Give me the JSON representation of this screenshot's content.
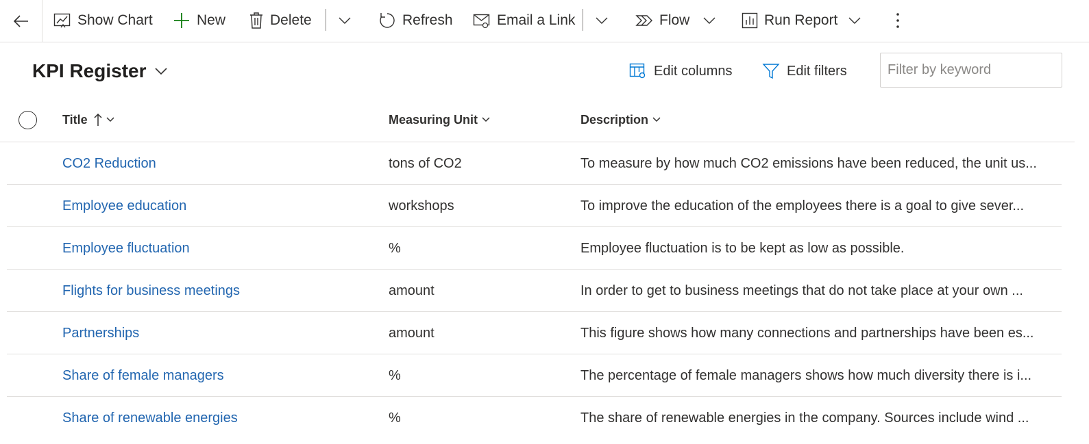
{
  "commandbar": {
    "back_label": "Back",
    "show_chart": "Show Chart",
    "new": "New",
    "delete": "Delete",
    "refresh": "Refresh",
    "email_link": "Email a Link",
    "flow": "Flow",
    "run_report": "Run Report",
    "more_icon": "more-vertical-icon"
  },
  "view": {
    "title": "KPI Register",
    "edit_columns": "Edit columns",
    "edit_filters": "Edit filters",
    "filter_placeholder": "Filter by keyword"
  },
  "grid": {
    "columns": {
      "title": "Title",
      "unit": "Measuring Unit",
      "description": "Description"
    },
    "rows": [
      {
        "title": "CO2 Reduction",
        "unit": "tons of CO2",
        "description": "To measure by how much CO2 emissions have been reduced, the unit us..."
      },
      {
        "title": "Employee education",
        "unit": "workshops",
        "description": "To improve the education of the employees there is a goal to give sever..."
      },
      {
        "title": "Employee fluctuation",
        "unit": "%",
        "description": "Employee fluctuation is to be kept as low as possible."
      },
      {
        "title": "Flights for business meetings",
        "unit": "amount",
        "description": "In order to get to business meetings that do not take place at your own ..."
      },
      {
        "title": "Partnerships",
        "unit": "amount",
        "description": "This figure shows how many connections and partnerships have been es..."
      },
      {
        "title": "Share of female managers",
        "unit": "%",
        "description": "The percentage of female managers shows how much diversity there is i..."
      },
      {
        "title": "Share of renewable energies",
        "unit": "%",
        "description": "The share of renewable energies in the company. Sources include wind ..."
      }
    ]
  },
  "colors": {
    "link": "#2266b0",
    "text": "#323130",
    "accent": "#0078d4",
    "new_icon": "#107c10",
    "divider": "#e1dfdd"
  }
}
